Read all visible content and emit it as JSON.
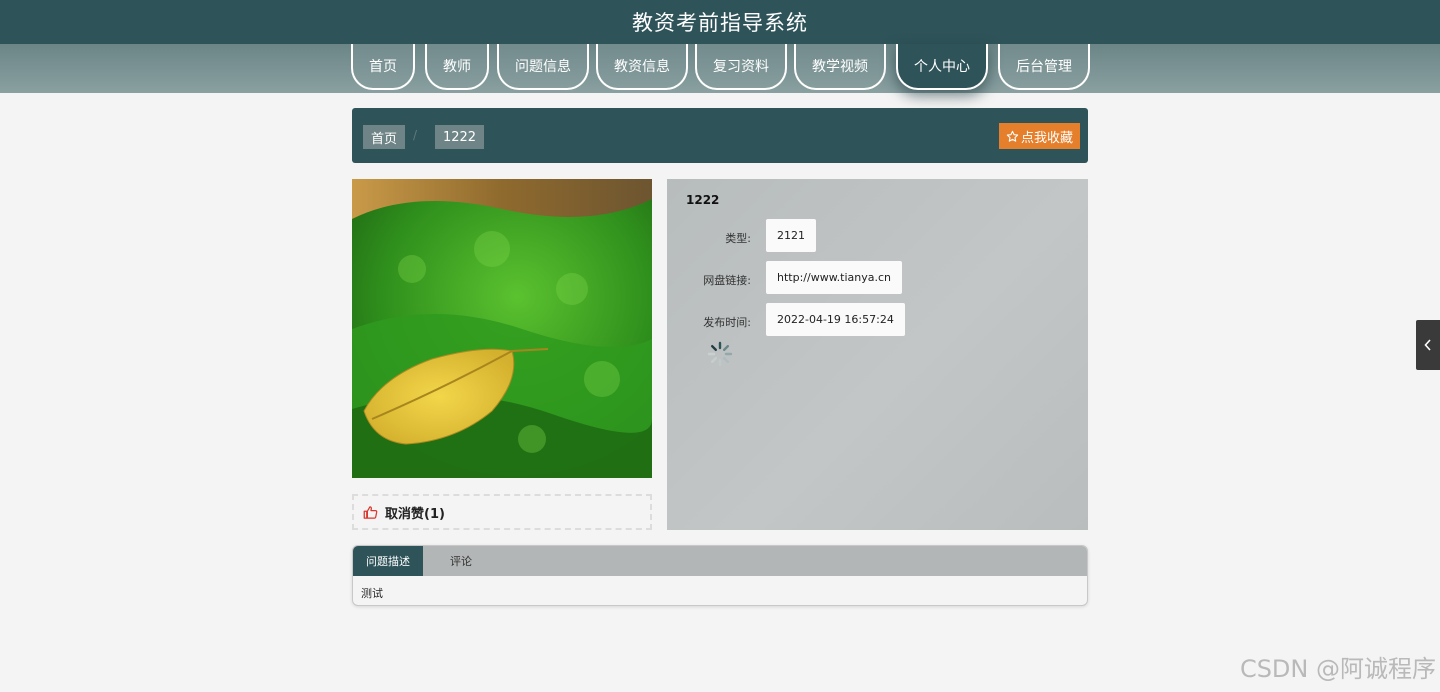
{
  "header": {
    "title": "教资考前指导系统"
  },
  "nav": {
    "items": [
      {
        "label": "首页"
      },
      {
        "label": "教师"
      },
      {
        "label": "问题信息"
      },
      {
        "label": "教资信息"
      },
      {
        "label": "复习资料"
      },
      {
        "label": "教学视频"
      },
      {
        "label": "个人中心"
      },
      {
        "label": "后台管理"
      }
    ],
    "active_index": 6
  },
  "breadcrumb": {
    "home": "首页",
    "current": "1222",
    "separator": "/"
  },
  "favorite_button": {
    "label": "点我收藏",
    "icon": "star-outline-icon"
  },
  "like": {
    "label": "取消赞(1)",
    "icon": "thumbs-up-icon"
  },
  "detail": {
    "title": "1222",
    "fields": [
      {
        "label": "类型:",
        "value": "2121"
      },
      {
        "label": "网盘链接:",
        "value": "http://www.tianya.cn"
      },
      {
        "label": "发布时间:",
        "value": "2022-04-19 16:57:24"
      }
    ]
  },
  "tabs": {
    "items": [
      {
        "label": "问题描述"
      },
      {
        "label": "评论"
      }
    ],
    "active_index": 0,
    "content": "测试"
  },
  "watermark": "CSDN @阿诚程序",
  "colors": {
    "primary": "#2e5359",
    "accent": "#e57f2b",
    "nav_bg": "#7c9395",
    "panel_bg": "#bcc0c0",
    "like_icon": "#d9362b"
  }
}
